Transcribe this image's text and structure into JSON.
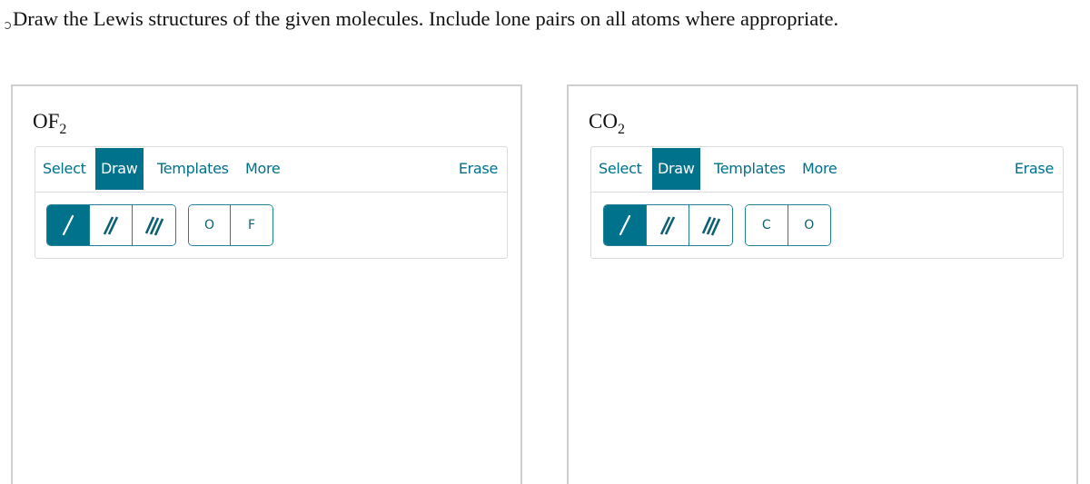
{
  "question": {
    "text": "Draw the Lewis structures of the given molecules. Include lone pairs on all atoms where appropriate."
  },
  "colors": {
    "accent": "#00728c",
    "tab_text": "#00708a",
    "panel_border": "#cfcfcf",
    "toolbar_border": "#dcdcdc"
  },
  "panels": [
    {
      "formula_main": "OF",
      "formula_sub": "2",
      "tabs": {
        "select": "Select",
        "draw": "Draw",
        "templates": "Templates",
        "more": "More",
        "erase": "Erase"
      },
      "active_tab": "Draw",
      "bonds": [
        {
          "name": "single-bond",
          "icon": "single-bond-icon",
          "active": true
        },
        {
          "name": "double-bond",
          "icon": "double-bond-icon",
          "active": false
        },
        {
          "name": "triple-bond",
          "icon": "triple-bond-icon",
          "active": false
        }
      ],
      "atoms": [
        "O",
        "F"
      ]
    },
    {
      "formula_main": "CO",
      "formula_sub": "2",
      "tabs": {
        "select": "Select",
        "draw": "Draw",
        "templates": "Templates",
        "more": "More",
        "erase": "Erase"
      },
      "active_tab": "Draw",
      "bonds": [
        {
          "name": "single-bond",
          "icon": "single-bond-icon",
          "active": true
        },
        {
          "name": "double-bond",
          "icon": "double-bond-icon",
          "active": false
        },
        {
          "name": "triple-bond",
          "icon": "triple-bond-icon",
          "active": false
        }
      ],
      "atoms": [
        "C",
        "O"
      ]
    }
  ]
}
